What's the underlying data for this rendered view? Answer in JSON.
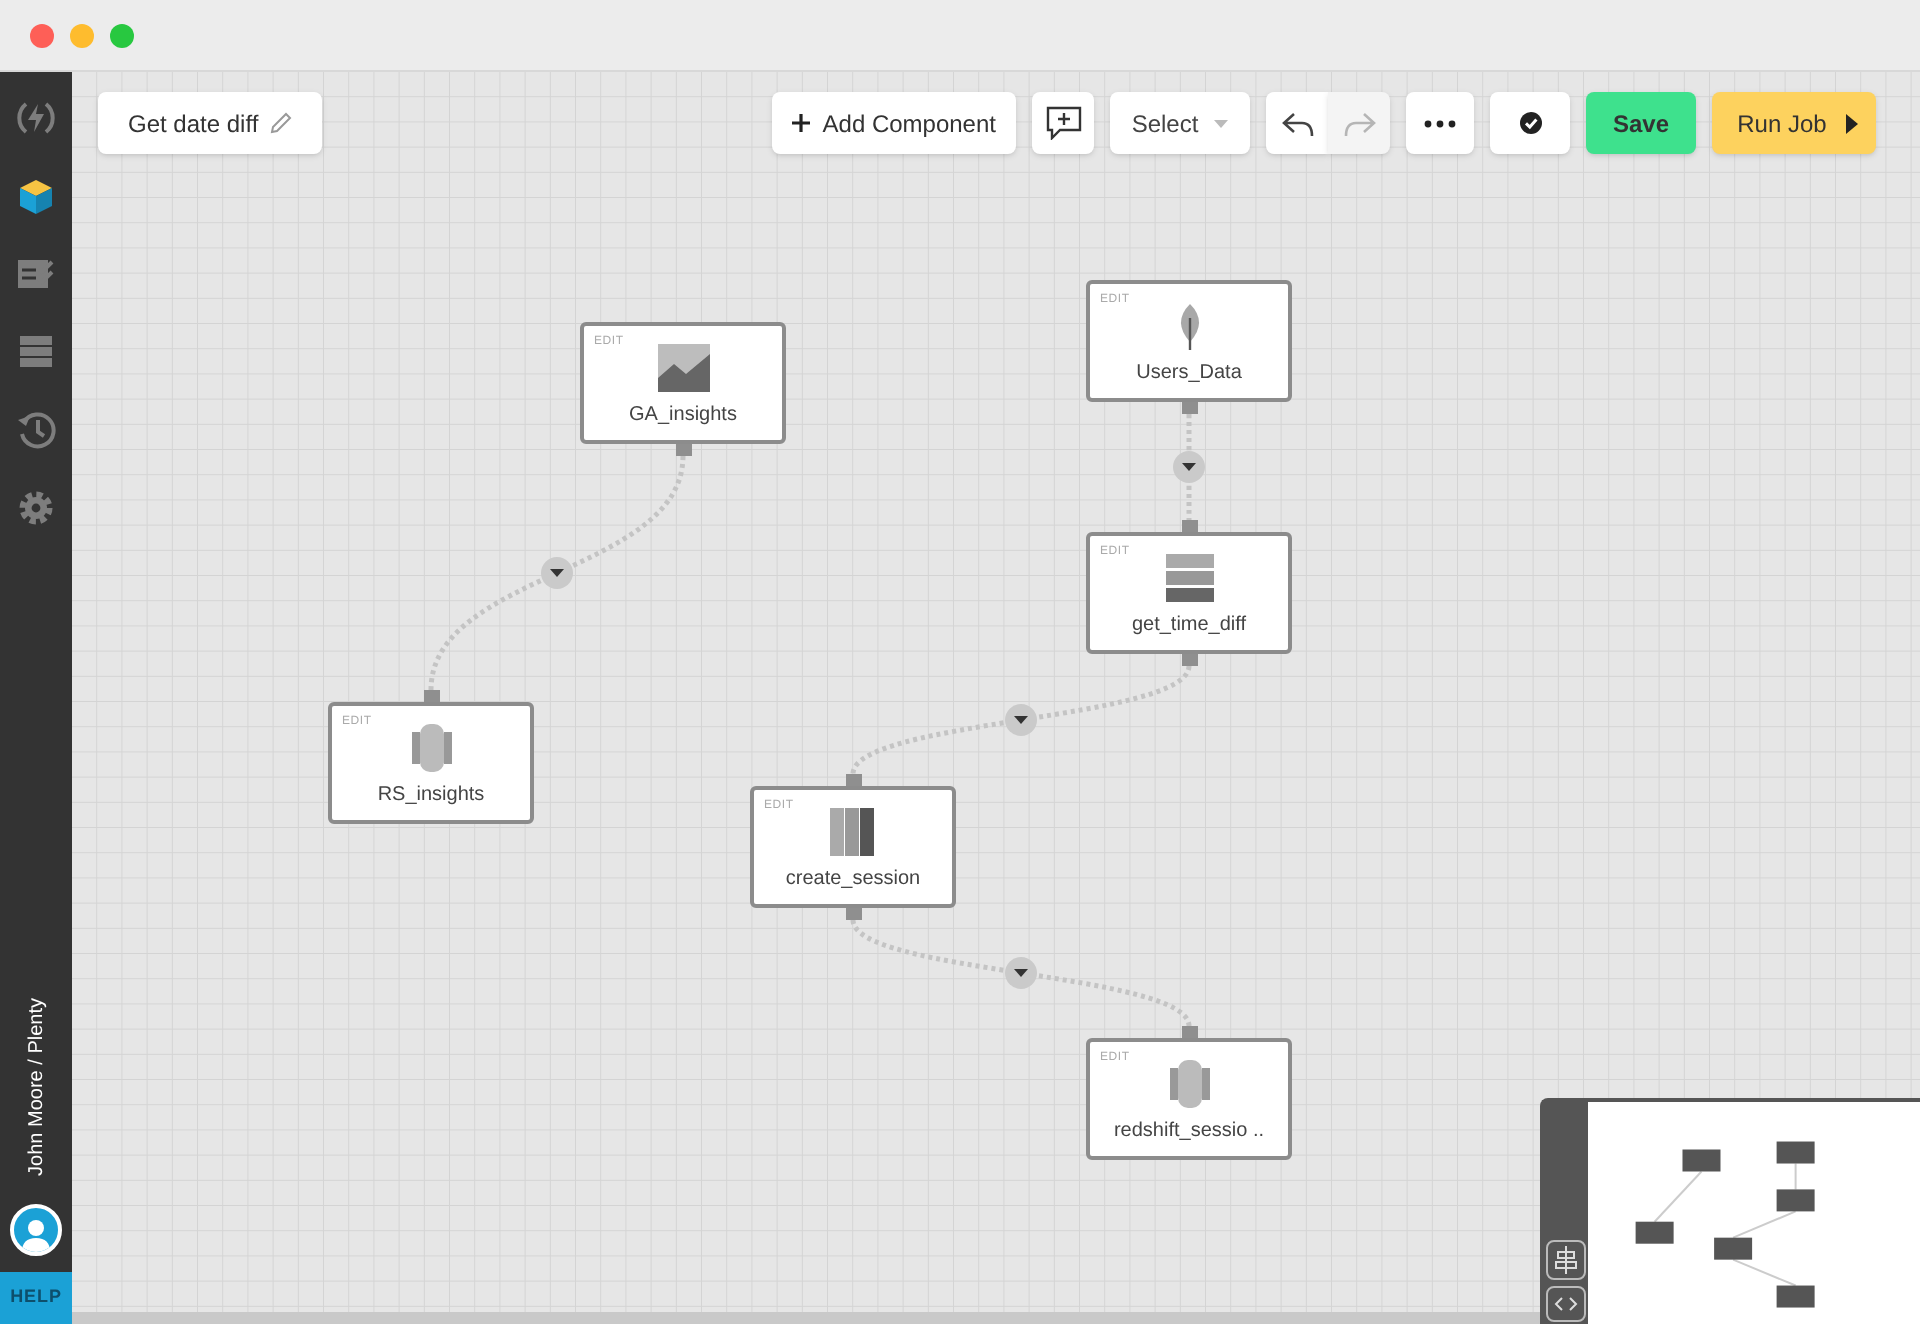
{
  "sidebar": {
    "items": [
      {
        "kind": "bolt",
        "selected": false
      },
      {
        "kind": "cube",
        "selected": true
      },
      {
        "kind": "checklist",
        "selected": false
      },
      {
        "kind": "database",
        "selected": false
      },
      {
        "kind": "history",
        "selected": false
      },
      {
        "kind": "gear",
        "selected": false
      }
    ],
    "user": "John Moore / Plenty",
    "help": "HELP"
  },
  "job_name": "Get date diff",
  "toolbar": [
    {
      "kind": "add",
      "label": "Add Component"
    },
    {
      "kind": "comment"
    },
    {
      "kind": "select",
      "label": "Select"
    },
    {
      "kind": "undo",
      "disabled": false
    },
    {
      "kind": "redo",
      "disabled": true
    },
    {
      "kind": "more"
    },
    {
      "kind": "validate"
    },
    {
      "kind": "save",
      "label": "Save"
    },
    {
      "kind": "run",
      "label": "Run Job"
    }
  ],
  "nodes": [
    {
      "kind": "chart",
      "label": "GA_insights",
      "edit": "EDIT"
    },
    {
      "kind": "leaf",
      "label": "Users_Data",
      "edit": "EDIT"
    },
    {
      "kind": "stack",
      "label": "get_time_diff",
      "edit": "EDIT"
    },
    {
      "kind": "cylinder",
      "label": "RS_insights",
      "edit": "EDIT"
    },
    {
      "kind": "columns",
      "label": "create_session",
      "edit": "EDIT"
    },
    {
      "kind": "cylinder",
      "label": "redshift_sessio ..",
      "edit": "EDIT"
    }
  ]
}
